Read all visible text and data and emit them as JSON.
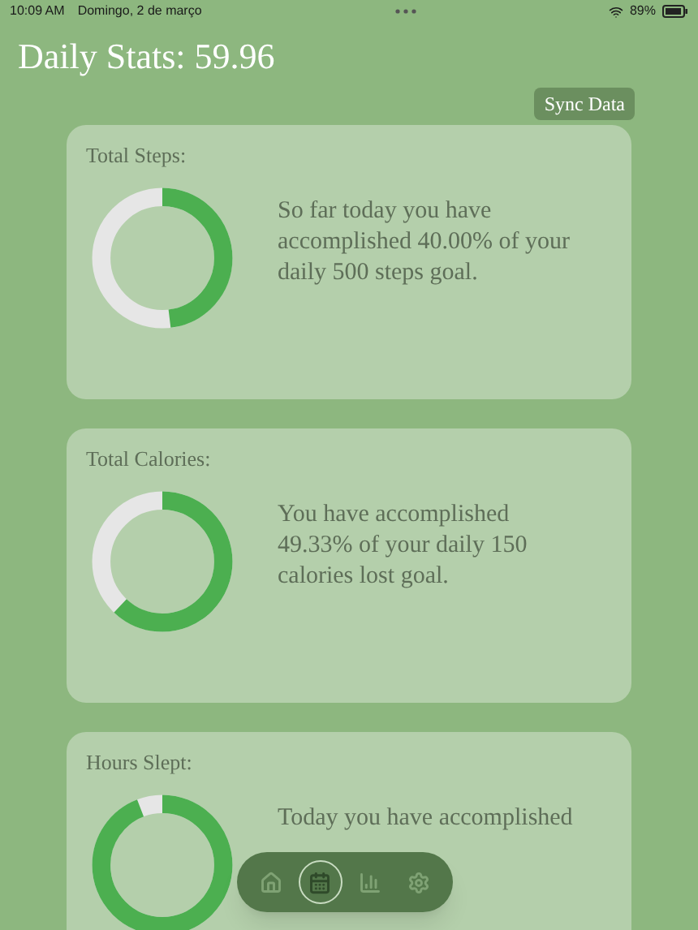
{
  "status_bar": {
    "time": "10:09 AM",
    "date": "Domingo, 2 de março",
    "battery": "89%"
  },
  "title": "Daily Stats: 59.96",
  "sync_button": "Sync Data",
  "cards": [
    {
      "title": "Total Steps:",
      "level": 0.48,
      "text": "So far today you have accomplished 40.00% of your daily 500 steps goal."
    },
    {
      "title": "Total Calories:",
      "level": 0.62,
      "text": "You have accomplished 49.33% of your daily 150 calories lost goal."
    },
    {
      "title": "Hours Slept:",
      "level": 0.94,
      "text": "Today you have accomplished"
    }
  ],
  "nav": [
    {
      "kind": "home",
      "selected": false
    },
    {
      "kind": "calendar",
      "selected": true
    },
    {
      "kind": "chart",
      "selected": false
    },
    {
      "kind": "settings",
      "selected": false
    }
  ]
}
